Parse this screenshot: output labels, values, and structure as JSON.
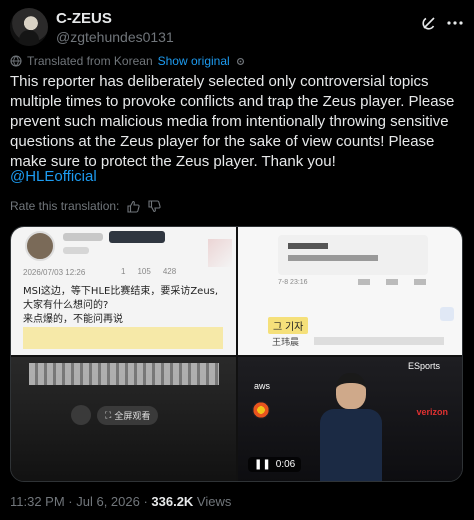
{
  "header": {
    "name": "C-ZEUS",
    "handle": "@zgtehundes0131"
  },
  "translation": {
    "label": "Translated from Korean",
    "show_original": "Show original",
    "rate_label": "Rate this translation:"
  },
  "tweet": {
    "body": "This reporter has deliberately selected only controversial topics multiple times to provoke conflicts and trap the Zeus player. Please prevent such malicious media from intentionally throwing sensitive questions at the Zeus player for the sake of view counts! Please make sure to protect the Zeus player. Thank you!",
    "mention": "@HLEofficial"
  },
  "media": {
    "p1": {
      "date": "2026/07/03 12:26",
      "count_a": "1",
      "count_b": "105",
      "count_c": "428",
      "line1": "MSI这边，等下HLE比赛结束，要采访Zeus,",
      "line2": "大家有什么想问的?",
      "line3": "来点爆的，不能问再说"
    },
    "p2": {
      "date": "7-8 23:16",
      "tag": "그 기자",
      "name_line": "王玮晨"
    },
    "p3": {
      "button": "全屏观看"
    },
    "p4": {
      "org": "ESports",
      "time": "0:06",
      "brand1": "verizon",
      "brand2": "aws"
    }
  },
  "footer": {
    "time": "11:32 PM · Jul 6, 2026 · ",
    "views_count": "336.2K",
    "views_label": " Views"
  },
  "colors": {
    "accent": "#1d9bf0",
    "muted": "#71767b",
    "text": "#e7e9ea"
  }
}
